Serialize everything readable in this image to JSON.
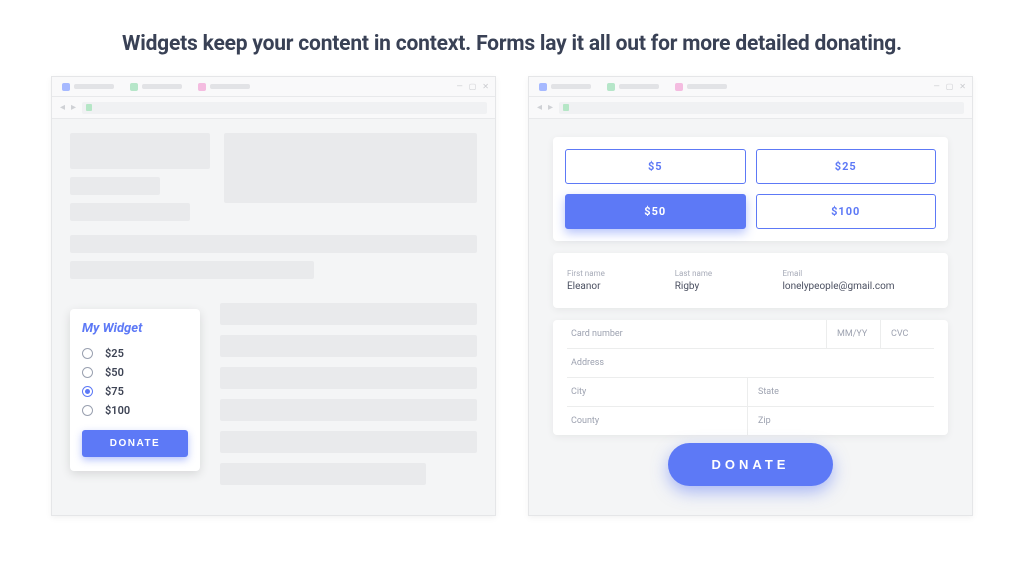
{
  "headline": "Widgets keep your content in context.  Forms lay it all out for more detailed donating.",
  "widget": {
    "title": "My Widget",
    "options": [
      {
        "label": "$25",
        "selected": false
      },
      {
        "label": "$50",
        "selected": false
      },
      {
        "label": "$75",
        "selected": true
      },
      {
        "label": "$100",
        "selected": false
      }
    ],
    "button_label": "DONATE"
  },
  "form": {
    "amounts": [
      {
        "label": "$5",
        "selected": false
      },
      {
        "label": "$25",
        "selected": false
      },
      {
        "label": "$50",
        "selected": true
      },
      {
        "label": "$100",
        "selected": false
      }
    ],
    "contact": {
      "first_name": {
        "label": "First name",
        "value": "Eleanor"
      },
      "last_name": {
        "label": "Last name",
        "value": "Rigby"
      },
      "email": {
        "label": "Email",
        "value": "lonelypeople@gmail.com"
      }
    },
    "payment_placeholders": {
      "card_number": "Card number",
      "mm_yy": "MM/YY",
      "cvc": "CVC",
      "address": "Address",
      "city": "City",
      "state": "State",
      "county": "County",
      "zip": "Zip"
    },
    "button_label": "DONATE"
  },
  "colors": {
    "accent": "#5d79f6",
    "text_dark": "#394155"
  }
}
